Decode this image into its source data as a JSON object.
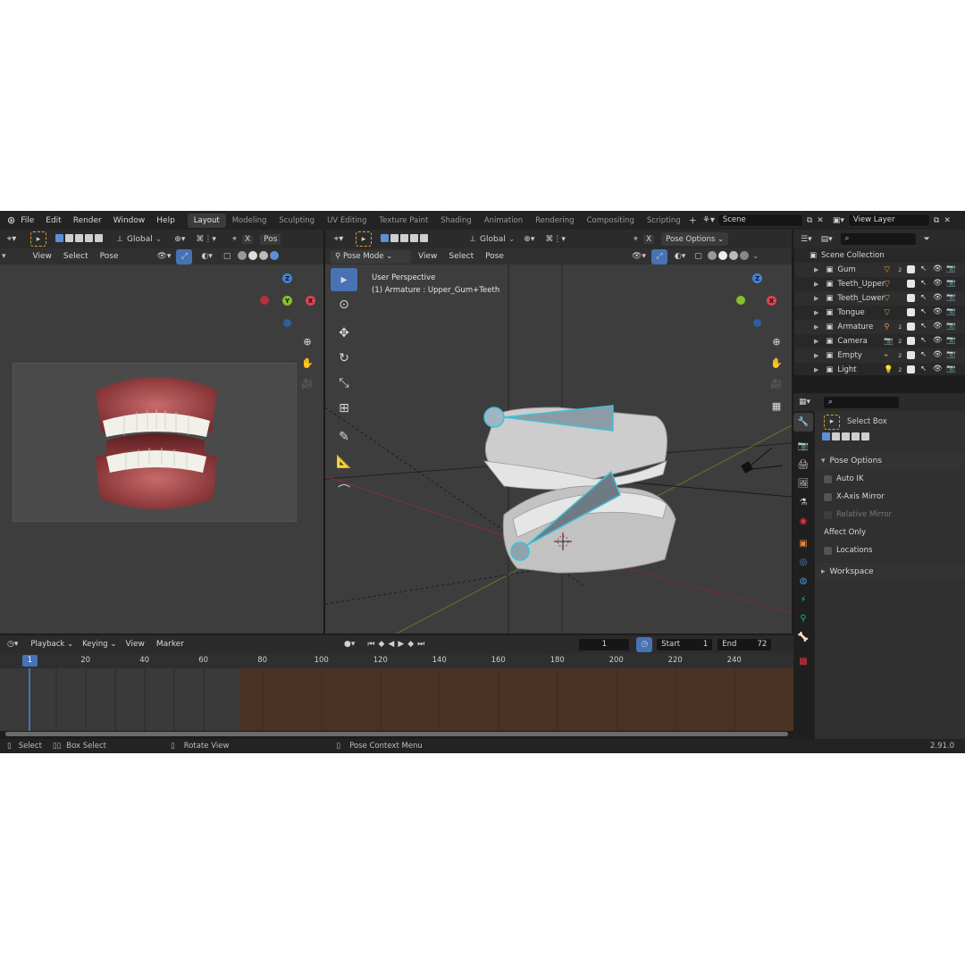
{
  "topbar": {
    "menus": [
      "File",
      "Edit",
      "Render",
      "Window",
      "Help"
    ],
    "tabs": [
      "Layout",
      "Modeling",
      "Sculpting",
      "UV Editing",
      "Texture Paint",
      "Shading",
      "Animation",
      "Rendering",
      "Compositing",
      "Scripting"
    ],
    "active_tab": "Layout",
    "scene": "Scene",
    "view_layer": "View Layer"
  },
  "left_view": {
    "orientation": "Global",
    "pos_trunc": "Pos",
    "menus": [
      "View",
      "Select",
      "Pose"
    ]
  },
  "main_view": {
    "orientation": "Global",
    "mode": "Pose Mode",
    "menus": [
      "View",
      "Select",
      "Pose"
    ],
    "pose_options": "Pose Options",
    "perspective": "User Perspective",
    "active_object": "(1) Armature : Upper_Gum+Teeth"
  },
  "gizmo": {
    "z": "Z",
    "x": "X",
    "y": "Y"
  },
  "outliner": {
    "collection": "Scene Collection",
    "items": [
      {
        "name": "Gum",
        "badge": "2"
      },
      {
        "name": "Teeth_Upper",
        "badge": ""
      },
      {
        "name": "Teeth_Lower",
        "badge": ""
      },
      {
        "name": "Tongue",
        "badge": ""
      },
      {
        "name": "Armature",
        "badge": "2"
      },
      {
        "name": "Camera",
        "badge": "2"
      },
      {
        "name": "Empty",
        "badge": "2"
      },
      {
        "name": "Light",
        "badge": "2"
      }
    ]
  },
  "properties": {
    "tool_name": "Select Box",
    "panel": "Pose Options",
    "auto_ik": "Auto IK",
    "x_mirror": "X-Axis Mirror",
    "relative_mirror": "Relative Mirror",
    "affect_only": "Affect Only",
    "locations": "Locations",
    "workspace": "Workspace"
  },
  "timeline": {
    "menus": [
      "Playback",
      "Keying",
      "View",
      "Marker"
    ],
    "current_frame": "1",
    "start_label": "Start",
    "start": "1",
    "end_label": "End",
    "end": "72",
    "playhead_label": "1",
    "ticks": [
      "20",
      "40",
      "60",
      "80",
      "100",
      "120",
      "140",
      "160",
      "180",
      "200",
      "220",
      "240"
    ]
  },
  "status": {
    "select": "Select",
    "box_select": "Box Select",
    "rotate_view": "Rotate View",
    "context_menu": "Pose Context Menu",
    "version": "2.91.0"
  },
  "colors": {
    "accent": "#4772b3",
    "bone_outline": "#3fc1d6",
    "axis_x": "#e0414f",
    "axis_y": "#84c227",
    "axis_z": "#3f84d8",
    "timeline_range": "#3a3a3a",
    "timeline_out": "#4a3225"
  }
}
